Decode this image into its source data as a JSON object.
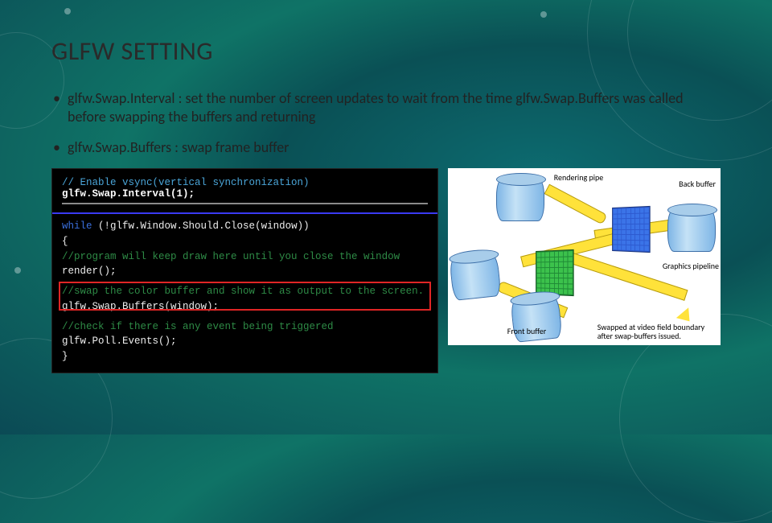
{
  "title": "GLFW SETTING",
  "bullets": [
    "glfw.Swap.Interval : set the number of screen updates to wait from the time\nglfw.Swap.Buffers was called before swapping the buffers and returning",
    "glfw.Swap.Buffers : swap frame buffer"
  ],
  "code": {
    "comment_head": "// Enable vsync(vertical synchronization)",
    "call_head": "glfw.Swap.Interval(1);",
    "lines": {
      "while_open": "while (!glfw.Window.Should.Close(window))",
      "brace_open": "{",
      "cm_draw": "    //program will keep draw here until you close the window",
      "render": "    render();",
      "cm_swap": "    //swap the color buffer and show it as output to the screen.",
      "swap": "    glfw.Swap.Buffers(window);",
      "cm_poll": "    //check if there is any event being triggered",
      "poll": "    glfw.Poll.Events();",
      "brace_close": "}"
    }
  },
  "diagram": {
    "label_render": "Rendering\npipe",
    "label_back": "Back\nbuffer",
    "label_graphics": "Graphics\npipeline",
    "label_front": "Front\nbuffer",
    "label_swap": "Swapped at video field boundary\nafter swap-buffers issued."
  }
}
